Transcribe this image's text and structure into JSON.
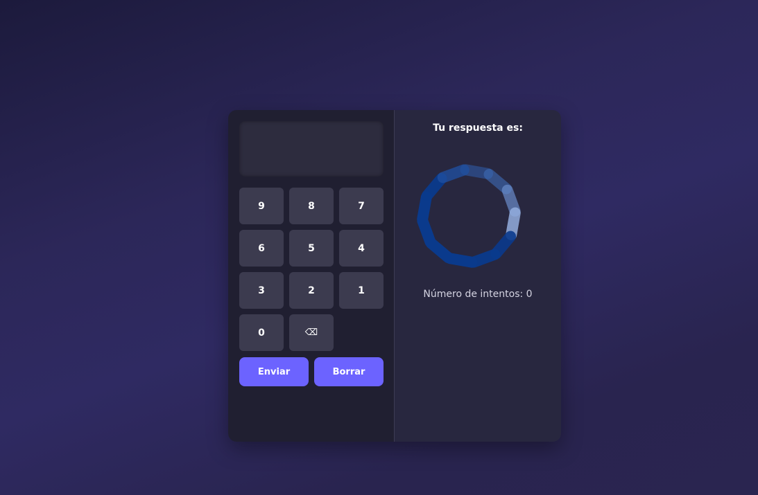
{
  "display": {
    "value": ""
  },
  "keypad": {
    "keys": [
      "9",
      "8",
      "7",
      "6",
      "5",
      "4",
      "3",
      "2",
      "1",
      "0",
      "⌫"
    ]
  },
  "actions": {
    "submit_label": "Enviar",
    "clear_label": "Borrar"
  },
  "result": {
    "title": "Tu respuesta es:",
    "attempts_label": "Número de intentos: 0"
  },
  "colors": {
    "accent": "#6c63ff",
    "spinner": "#0a3a8c",
    "panel_left": "#201f31",
    "panel_right": "#28273f"
  },
  "icons": {
    "loading": "loading-spinner-icon",
    "backspace": "backspace-icon"
  }
}
